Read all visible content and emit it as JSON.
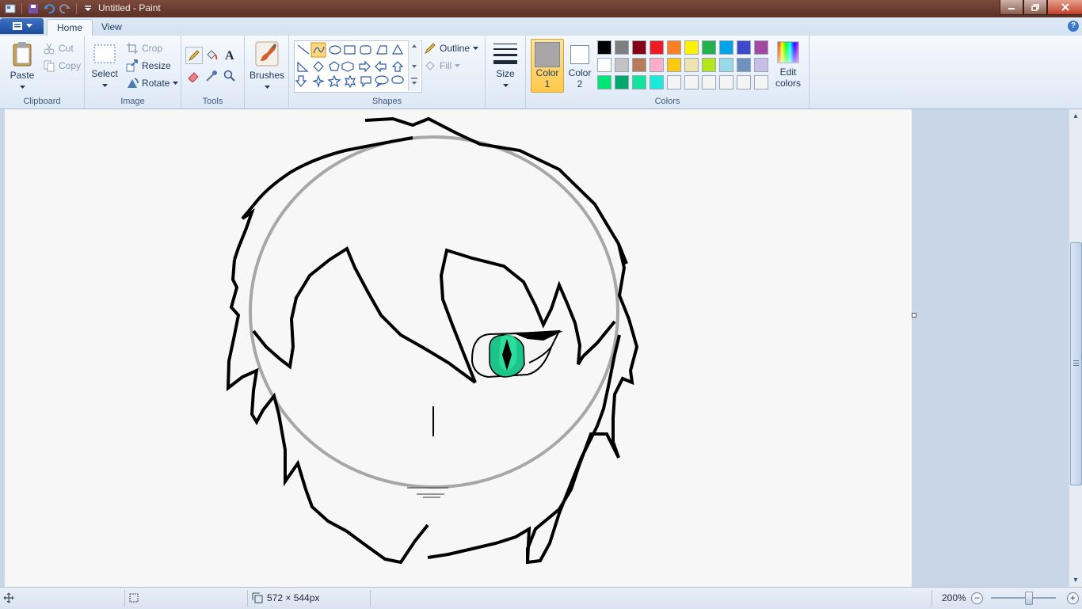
{
  "window": {
    "title": "Untitled - Paint",
    "quick_access": [
      "save-icon",
      "undo-icon",
      "redo-icon",
      "customize-qat-icon"
    ]
  },
  "tabs": [
    {
      "label": "Home",
      "active": true
    },
    {
      "label": "View",
      "active": false
    }
  ],
  "ribbon": {
    "clipboard": {
      "group_label": "Clipboard",
      "paste": "Paste",
      "cut": "Cut",
      "copy": "Copy"
    },
    "image": {
      "group_label": "Image",
      "select": "Select",
      "crop": "Crop",
      "resize": "Resize",
      "rotate": "Rotate"
    },
    "tools": {
      "group_label": "Tools",
      "items": [
        "pencil-icon",
        "fill-icon",
        "text-icon",
        "eraser-icon",
        "color-picker-icon",
        "magnifier-icon"
      ]
    },
    "brushes": {
      "label": "Brushes"
    },
    "shapes": {
      "group_label": "Shapes",
      "outline": "Outline",
      "fill": "Fill",
      "selected": "curve"
    },
    "size": {
      "label": "Size"
    },
    "colors": {
      "group_label": "Colors",
      "color1": {
        "label_line1": "Color",
        "label_line2": "1",
        "value": "#a8a6a6"
      },
      "color2": {
        "label_line1": "Color",
        "label_line2": "2",
        "value": "#ffffff"
      },
      "edit": {
        "label_line1": "Edit",
        "label_line2": "colors"
      },
      "palette_row1": [
        "#000000",
        "#7f7f7f",
        "#880015",
        "#ed1c24",
        "#ff7f27",
        "#fff200",
        "#22b14c",
        "#00a2e8",
        "#3f48cc",
        "#a349a4"
      ],
      "palette_row2": [
        "#ffffff",
        "#c3c3c3",
        "#b97a57",
        "#ffaec9",
        "#ffc90e",
        "#efe4b0",
        "#b5e61d",
        "#99d9ea",
        "#7092be",
        "#c8bfe7"
      ],
      "palette_row3": [
        "#00e676",
        "#00a86b",
        "#14e39e",
        "#1de9d9",
        "#f4f4f4",
        "#f4f4f4",
        "#f4f4f4",
        "#f4f4f4",
        "#f4f4f4",
        "#f4f4f4"
      ]
    }
  },
  "status": {
    "image_size": "572 × 544px",
    "zoom": "200%"
  }
}
